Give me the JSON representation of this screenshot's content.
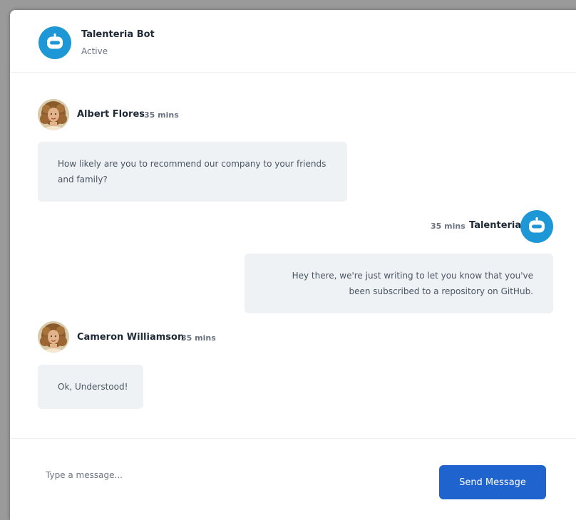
{
  "header": {
    "title": "Talenteria Bot",
    "status": "Active",
    "avatar_icon": "robot-icon"
  },
  "messages": [
    {
      "sender": "Albert Flores",
      "time": "35 mins",
      "text": "How likely are you to recommend our company to your friends and family?",
      "direction": "incoming",
      "avatar": "user-photo"
    },
    {
      "sender": "Talenteria",
      "time": "35 mins",
      "text": "Hey there, we're just writing to let you know that you've been subscribed to a repository on GitHub.",
      "direction": "outgoing",
      "avatar": "robot-icon"
    },
    {
      "sender": "Cameron Williamson",
      "time": "35 mins",
      "text": "Ok, Understood!",
      "direction": "incoming",
      "avatar": "user-photo"
    }
  ],
  "composer": {
    "placeholder": "Type a message...",
    "value": "",
    "send_label": "Send Message"
  },
  "colors": {
    "bot_blue": "#1e97d6",
    "send_button": "#1f63cf",
    "bubble_bg": "#eef2f5",
    "name_text": "#1f2a37",
    "muted_text": "#6b7280"
  }
}
